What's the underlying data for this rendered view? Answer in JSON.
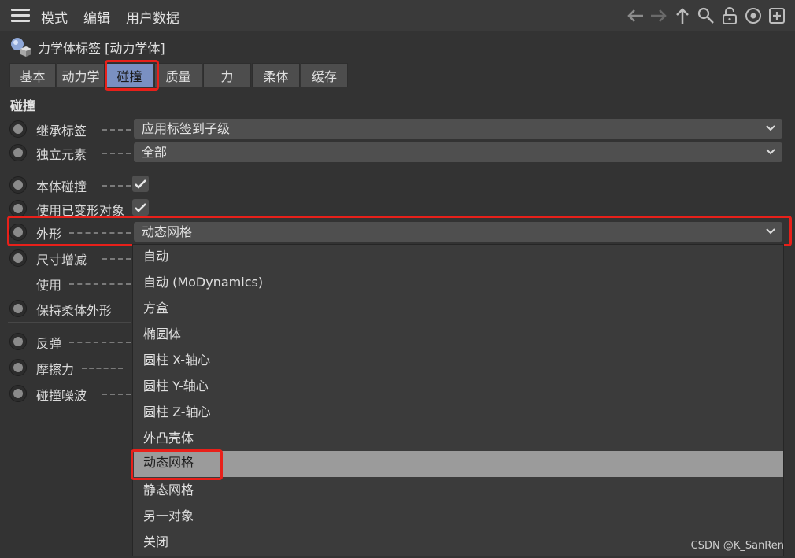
{
  "menu": {
    "items": [
      "模式",
      "编辑",
      "用户数据"
    ]
  },
  "toolbar": {
    "icons": [
      "arrow-left-icon",
      "arrow-right-icon",
      "arrow-up-icon",
      "search-icon",
      "lock-icon",
      "target-icon",
      "new-panel-icon"
    ]
  },
  "object": {
    "title": "力学体标签 [动力学体]"
  },
  "tabs": [
    {
      "label": "基本"
    },
    {
      "label": "动力学"
    },
    {
      "label": "碰撞",
      "active": true
    },
    {
      "label": "质量"
    },
    {
      "label": "力"
    },
    {
      "label": "柔体"
    },
    {
      "label": "缓存"
    }
  ],
  "section": {
    "title": "碰撞"
  },
  "attributes": {
    "inherit_tag": {
      "label": "继承标签",
      "value": "应用标签到子级"
    },
    "individual_elements": {
      "label": "独立元素",
      "value": "全部"
    },
    "self_collision": {
      "label": "本体碰撞",
      "checked": true
    },
    "use_deformed": {
      "label": "使用已变形对象",
      "checked": true
    },
    "shape": {
      "label": "外形",
      "value": "动态网格"
    },
    "size_increment": {
      "label": "尺寸增减"
    },
    "use": {
      "label": "使用"
    },
    "keep_soft_shape": {
      "label": "保持柔体外形"
    },
    "bounce": {
      "label": "反弹"
    },
    "friction": {
      "label": "摩擦力"
    },
    "collision_noise": {
      "label": "碰撞噪波"
    }
  },
  "dropdown": {
    "options": [
      "自动",
      "自动 (MoDynamics)",
      "方盒",
      "椭圆体",
      "圆柱 X-轴心",
      "圆柱 Y-轴心",
      "圆柱 Z-轴心",
      "外凸壳体",
      "动态网格",
      "静态网格",
      "另一对象",
      "关闭"
    ],
    "selected": "动态网格"
  },
  "colors": {
    "highlight": "#e8201a",
    "active_tab": "#7a90c2",
    "selected_option": "#9b9b9b"
  },
  "watermark": "CSDN @K_SanRen"
}
